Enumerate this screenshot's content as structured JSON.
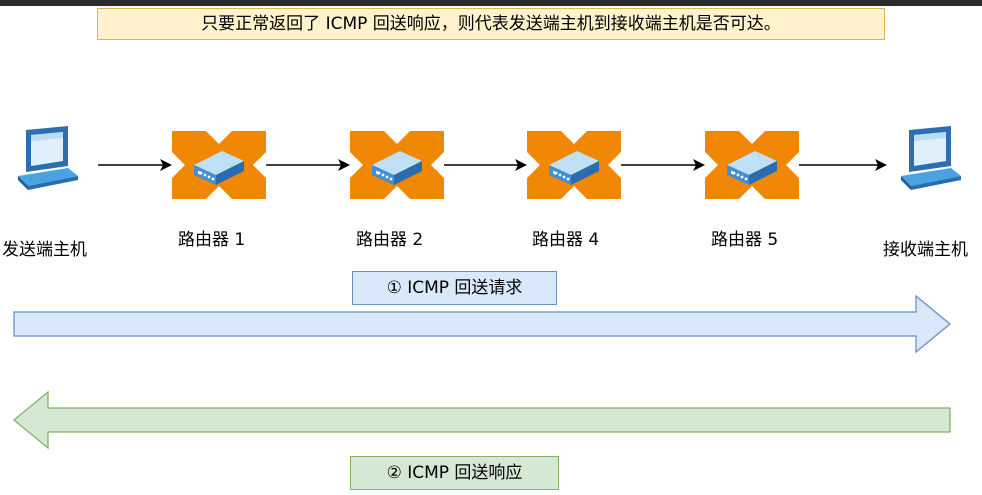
{
  "note": "只要正常返回了 ICMP 回送响应，则代表发送端主机到接收端主机是否可达。",
  "nodes": {
    "sender": "发送端主机",
    "router_1": "路由器 1",
    "router_2": "路由器 2",
    "router_4": "路由器 4",
    "router_5": "路由器 5",
    "receiver": "接收端主机"
  },
  "messages": {
    "request": "① ICMP 回送请求",
    "reply": "② ICMP 回送响应"
  },
  "colors": {
    "router_orange": "#f08705",
    "device_blue": "#3f8fd2",
    "request_fill": "#dae8fc",
    "request_stroke": "#6c8ebf",
    "reply_fill": "#d5e8d4",
    "reply_stroke": "#82b366",
    "note_fill": "#fff2cc",
    "note_stroke": "#d6b656"
  }
}
